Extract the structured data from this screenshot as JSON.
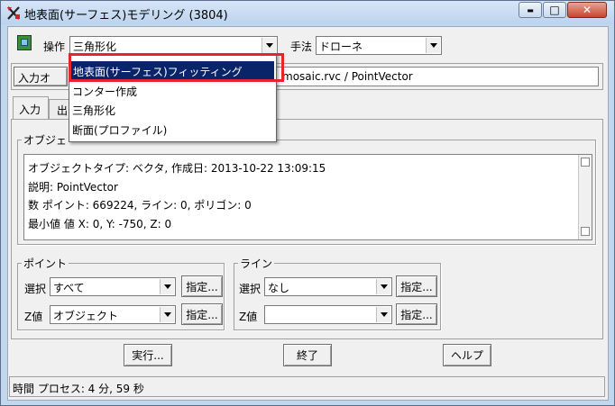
{
  "window": {
    "title": "地表面(サーフェス)モデリング (3804)"
  },
  "titlebar_controls": {
    "minimize": "▬",
    "maximize": "□",
    "close": "✕"
  },
  "operation": {
    "label": "操作",
    "value": "三角形化"
  },
  "method": {
    "label": "手法",
    "value": "ドローネ"
  },
  "input_object": {
    "label_visible": "入力オ",
    "path_visible": "mosaic.rvc / PointVector"
  },
  "tabs": [
    {
      "label": "入力"
    },
    {
      "label": "出"
    }
  ],
  "object_group": {
    "title_visible": "オブジェ",
    "lines": [
      "オブジェクトタイプ: ベクタ, 作成日: 2013-10-22 13:09:15",
      "説明: PointVector",
      "数 ポイント: 669224, ライン: 0, ポリゴン: 0",
      "最小値 値 X: 0, Y: -750, Z: 0"
    ]
  },
  "dropdown": {
    "items": [
      "地表面(サーフェス)フィッティング",
      "コンター作成",
      "三角形化",
      "断面(プロファイル)"
    ],
    "selected_index": 0
  },
  "point_group": {
    "title": "ポイント",
    "select_label": "選択",
    "select_value": "すべて",
    "select_button": "指定...",
    "z_label": "Z値",
    "z_value": "オブジェクト",
    "z_button": "指定..."
  },
  "line_group": {
    "title": "ライン",
    "select_label": "選択",
    "select_value": "なし",
    "select_button": "指定...",
    "z_label": "Z値",
    "z_value": "",
    "z_button": "指定..."
  },
  "actions": {
    "run": "実行...",
    "exit": "終了",
    "help": "ヘルプ"
  },
  "status": {
    "text": "時間 プロセス: 4 分, 59 秒"
  },
  "colors": {
    "highlight_border": "#e8232e",
    "selected_bg": "#0a246a"
  }
}
